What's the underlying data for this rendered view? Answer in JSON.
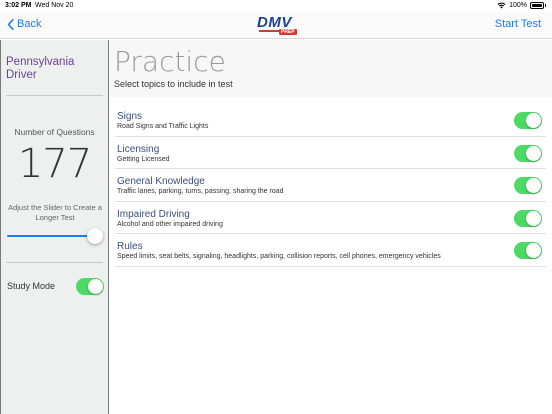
{
  "status": {
    "time": "3:02 PM",
    "date": "Wed Nov 20",
    "battery": "100%"
  },
  "nav": {
    "back_label": "Back",
    "logo_text": "DMV",
    "logo_badge": "PREP",
    "start_test_label": "Start Test"
  },
  "sidebar": {
    "driver_title": "Pennsylvania Driver",
    "questions_label": "Number of Questions",
    "questions_value": "177",
    "slider_hint": "Adjust the Slider to Create a Longer Test",
    "slider_level": 1.0,
    "study_mode_label": "Study Mode",
    "study_mode_on": true
  },
  "main": {
    "title": "Practice",
    "subtitle": "Select topics to include in test",
    "topics": [
      {
        "title": "Signs",
        "desc": "Road Signs and Traffic Lights",
        "enabled": true
      },
      {
        "title": "Licensing",
        "desc": "Getting Licensed",
        "enabled": true
      },
      {
        "title": "General Knowledge",
        "desc": "Traffic lanes, parking, turns, passing, sharing the road",
        "enabled": true
      },
      {
        "title": "Impaired Driving",
        "desc": "Alcohol and other impaired driving",
        "enabled": true
      },
      {
        "title": "Rules",
        "desc": "Speed limits, seat belts, signaling, headlights, parking, collision reports, cell phones, emergency vehicles",
        "enabled": true
      }
    ]
  },
  "colors": {
    "accent": "#1a7cf3",
    "toggle_on": "#4cd964",
    "driver_title": "#6b3fa0",
    "topic_title": "#3a4f7a"
  },
  "icons": {
    "back": "chevron-left-icon",
    "wifi": "wifi-icon",
    "battery": "battery-icon"
  }
}
